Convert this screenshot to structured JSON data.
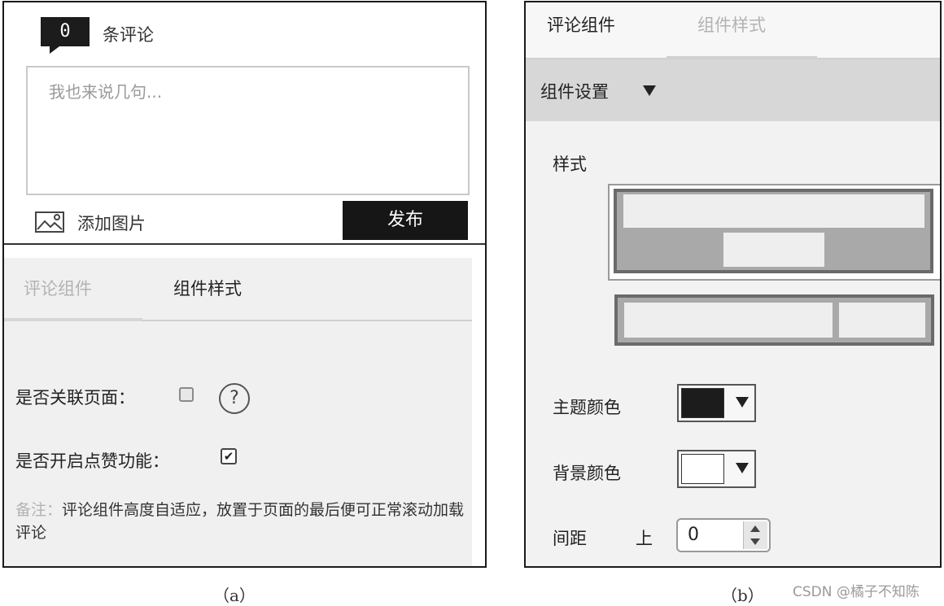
{
  "panel_a": {
    "comment_count": "0",
    "comment_count_label": "条评论",
    "comment_placeholder": "我也来说几句...",
    "add_image_label": "添加图片",
    "publish_label": "发布",
    "tabs": [
      "评论组件",
      "组件样式"
    ],
    "link_page_label": "是否关联页面：",
    "link_page_checked": false,
    "help_symbol": "?",
    "like_label": "是否开启点赞功能：",
    "like_checked": true,
    "checkmark": "✔",
    "note_prefix": "备注：",
    "note_text": "评论组件高度自适应，放置于页面的最后便可正常滚动加载评论",
    "caption": "（a）"
  },
  "panel_b": {
    "tabs": [
      "评论组件",
      "组件样式"
    ],
    "section_title": "组件设置",
    "style_label": "样式",
    "theme_color_label": "主题颜色",
    "theme_color": "#1c1c1c",
    "bg_color_label": "背景颜色",
    "bg_color": "#ffffff",
    "spacing_label": "间距",
    "spacing_top_label": "上",
    "spacing_top_value": "0",
    "caption": "（b）"
  },
  "watermark": "CSDN @橘子不知陈"
}
